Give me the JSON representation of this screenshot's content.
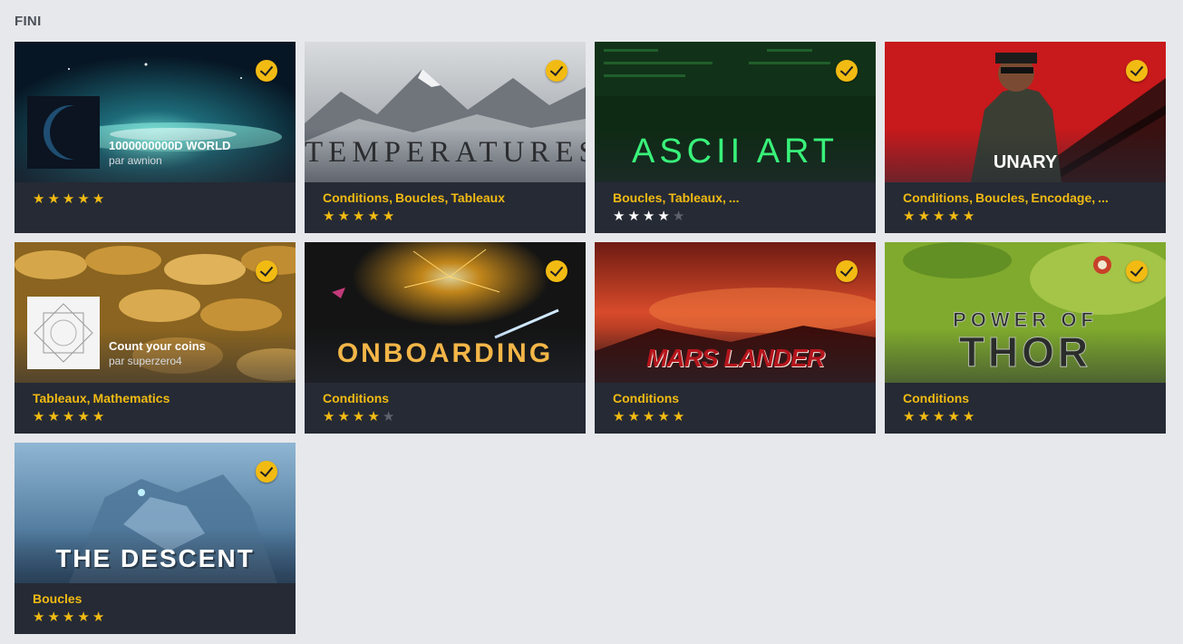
{
  "section": {
    "title": "FINI"
  },
  "colors": {
    "accent": "#f2bb13",
    "card_bg": "#252a35",
    "page_bg": "#e7e8eb"
  },
  "cards": [
    {
      "name": "1000000000D WORLD",
      "author": "par awnion",
      "tags": [],
      "rating": 5,
      "star_style": "gold",
      "completed": true,
      "completed_icon": "check-icon"
    },
    {
      "cover_title": "TEMPERATURES",
      "tags": [
        "Conditions",
        "Boucles",
        "Tableaux"
      ],
      "rating": 5,
      "star_style": "gold",
      "completed": true,
      "completed_icon": "check-icon"
    },
    {
      "cover_title": "ASCII ART",
      "tags": [
        "Boucles",
        "Tableaux",
        "..."
      ],
      "rating": 4,
      "star_style": "white",
      "completed": true,
      "completed_icon": "check-icon"
    },
    {
      "cover_title": "UNARY",
      "tags": [
        "Conditions",
        "Boucles",
        "Encodage",
        "..."
      ],
      "rating": 5,
      "star_style": "gold",
      "completed": true,
      "completed_icon": "check-icon"
    },
    {
      "name": "Count your coins",
      "author": "par superzero4",
      "tags": [
        "Tableaux",
        "Mathematics"
      ],
      "rating": 5,
      "star_style": "gold",
      "completed": true,
      "completed_icon": "check-icon"
    },
    {
      "cover_title": "ONBOARDING",
      "tags": [
        "Conditions"
      ],
      "rating": 4,
      "star_style": "gold",
      "completed": true,
      "completed_icon": "check-icon"
    },
    {
      "cover_title": "MARS LANDER",
      "tags": [
        "Conditions"
      ],
      "rating": 5,
      "star_style": "gold",
      "completed": true,
      "completed_icon": "check-icon"
    },
    {
      "cover_title_1": "POWER OF",
      "cover_title_2": "THOR",
      "tags": [
        "Conditions"
      ],
      "rating": 5,
      "star_style": "gold",
      "completed": true,
      "completed_icon": "check-icon"
    },
    {
      "cover_title": "THE DESCENT",
      "tags": [
        "Boucles"
      ],
      "rating": 5,
      "star_style": "gold",
      "completed": true,
      "completed_icon": "check-icon"
    }
  ]
}
